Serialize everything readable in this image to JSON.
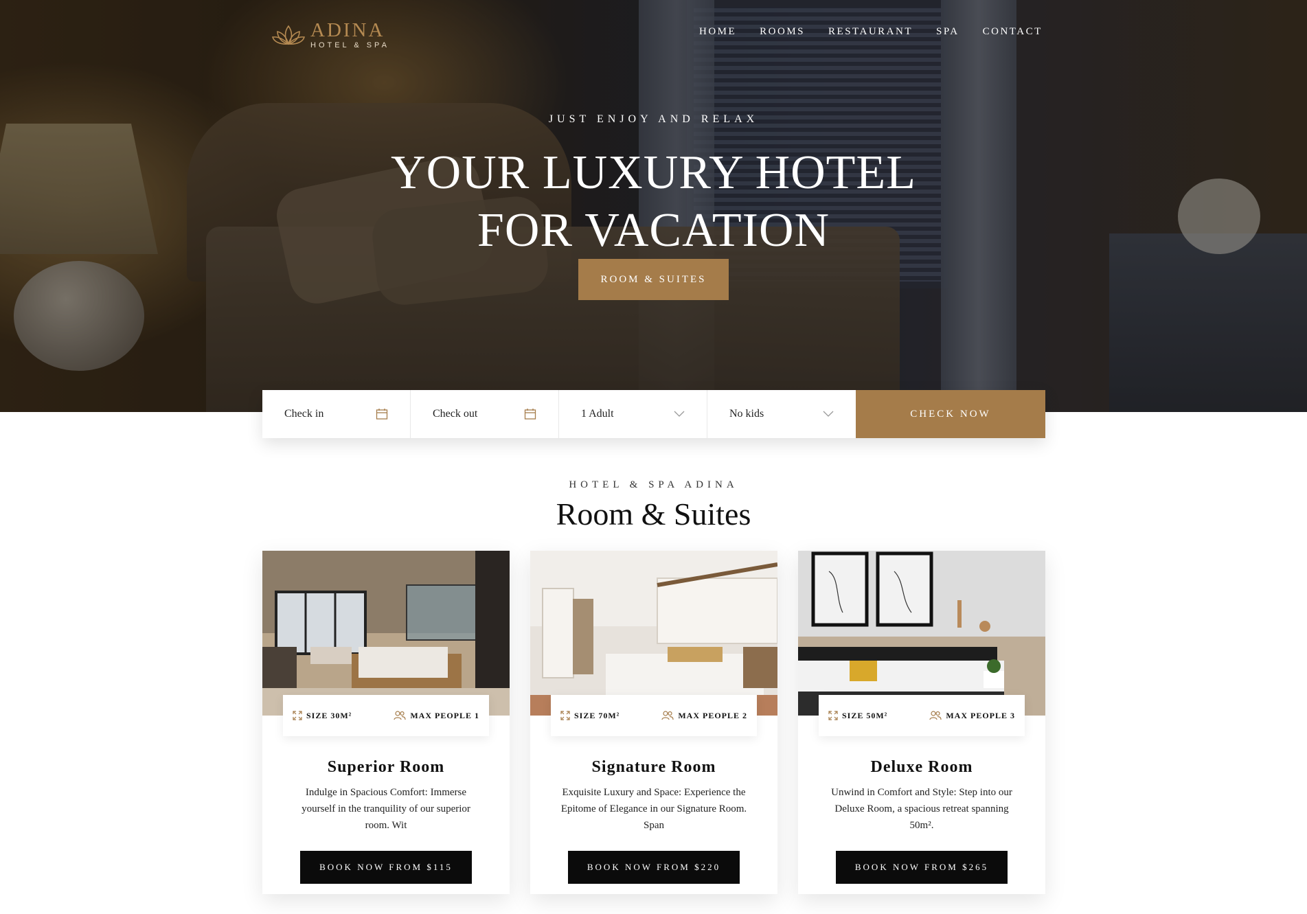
{
  "brand": {
    "title": "ADINA",
    "subtitle": "HOTEL & SPA",
    "icon": "lotus-icon"
  },
  "nav": [
    "HOME",
    "ROOMS",
    "RESTAURANT",
    "SPA",
    "CONTACT"
  ],
  "hero": {
    "kicker": "JUST ENJOY AND RELAX",
    "title_line1": "YOUR LUXURY HOTEL",
    "title_line2": "FOR VACATION",
    "button": "ROOM & SUITES"
  },
  "booking": {
    "check_in": "Check in",
    "check_out": "Check out",
    "adults": "1 Adult",
    "kids": "No kids",
    "button": "CHECK NOW"
  },
  "section": {
    "kicker": "HOTEL & SPA ADINA",
    "title": "Room & Suites"
  },
  "rooms": [
    {
      "size": "SIZE 30M²",
      "people": "MAX PEOPLE 1",
      "name": "Superior Room",
      "desc": "Indulge in Spacious Comfort: Immerse yourself in the tranquility of our superior room. Wit",
      "button": "BOOK NOW FROM $115"
    },
    {
      "size": "SIZE 70M²",
      "people": "MAX PEOPLE 2",
      "name": "Signature Room",
      "desc": "Exquisite Luxury and Space: Experience the Epitome of Elegance in our Signature Room. Span",
      "button": "BOOK NOW FROM $220"
    },
    {
      "size": "SIZE 50M²",
      "people": "MAX PEOPLE 3",
      "name": "Deluxe Room",
      "desc": "Unwind in Comfort and Style: Step into our Deluxe Room, a spacious retreat spanning 50m².",
      "button": "BOOK NOW FROM $265"
    }
  ],
  "colors": {
    "accent": "#a57c4a",
    "dark": "#0b0b0b"
  }
}
